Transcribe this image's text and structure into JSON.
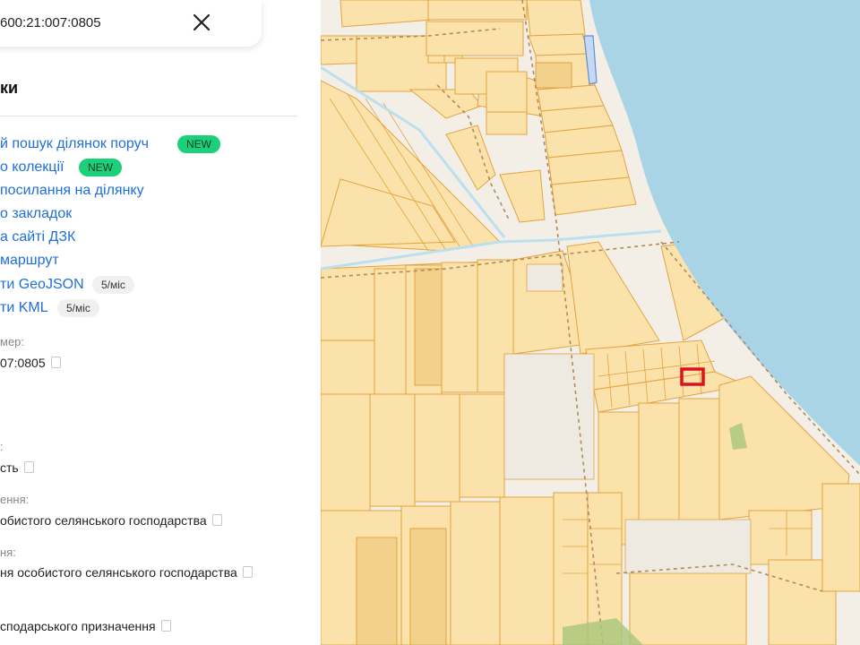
{
  "search": {
    "value": "600:21:007:0805"
  },
  "actions": {
    "section_title": "ки",
    "items": [
      {
        "label": "й пошук ділянок поруч",
        "badge": "NEW"
      },
      {
        "label": "о колекції",
        "badge": "NEW"
      },
      {
        "label": "посилання на ділянку"
      },
      {
        "label": "о закладок"
      },
      {
        "label": "а сайті ДЗК"
      },
      {
        "label": "маршрут"
      },
      {
        "label": "ти GeoJSON",
        "badge": "5/міс"
      },
      {
        "label": "ти KML",
        "badge": "5/міс"
      }
    ]
  },
  "details": {
    "number_label": "мер:",
    "number_value": "07:0805",
    "ownership_label": ":",
    "ownership_value": "сть",
    "purpose_label": "ення:",
    "purpose_value": "обистого селянського господарства",
    "usage_label": "ня:",
    "usage_value": "ня особистого селянського господарства",
    "category_value": "сподарського призначення"
  },
  "colors": {
    "link": "#1e6fd9",
    "badge_new": "#1ccf79",
    "water": "#a9d4e6",
    "parcel": "#fbe2aa",
    "parcel_border": "#e3a33f",
    "selected_parcel": "#e0101a"
  }
}
